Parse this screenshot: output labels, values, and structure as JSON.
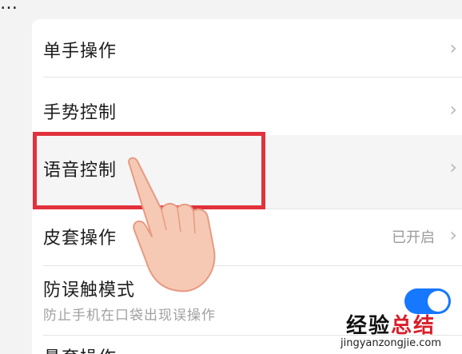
{
  "top_fragment": "…",
  "settings": {
    "items": [
      {
        "label": "单手操作"
      },
      {
        "label": "手势控制"
      },
      {
        "label": "语音控制"
      },
      {
        "label": "皮套操作",
        "status": "已开启"
      },
      {
        "label": "防误触模式",
        "sublabel": "防止手机在口袋出现误操作",
        "toggle_on": true
      },
      {
        "label": "悬套操作"
      }
    ],
    "chevron_glyph": "›"
  },
  "watermark": {
    "title_part1": "经验",
    "title_part2": "总结",
    "url": "jingyanzongjie.com"
  },
  "colors": {
    "highlight": "#e1323c",
    "toggle": "#1677ff",
    "watermark_red": "#d81e2a"
  },
  "icons": [
    "chevron-right-icon",
    "pointing-hand-icon"
  ]
}
